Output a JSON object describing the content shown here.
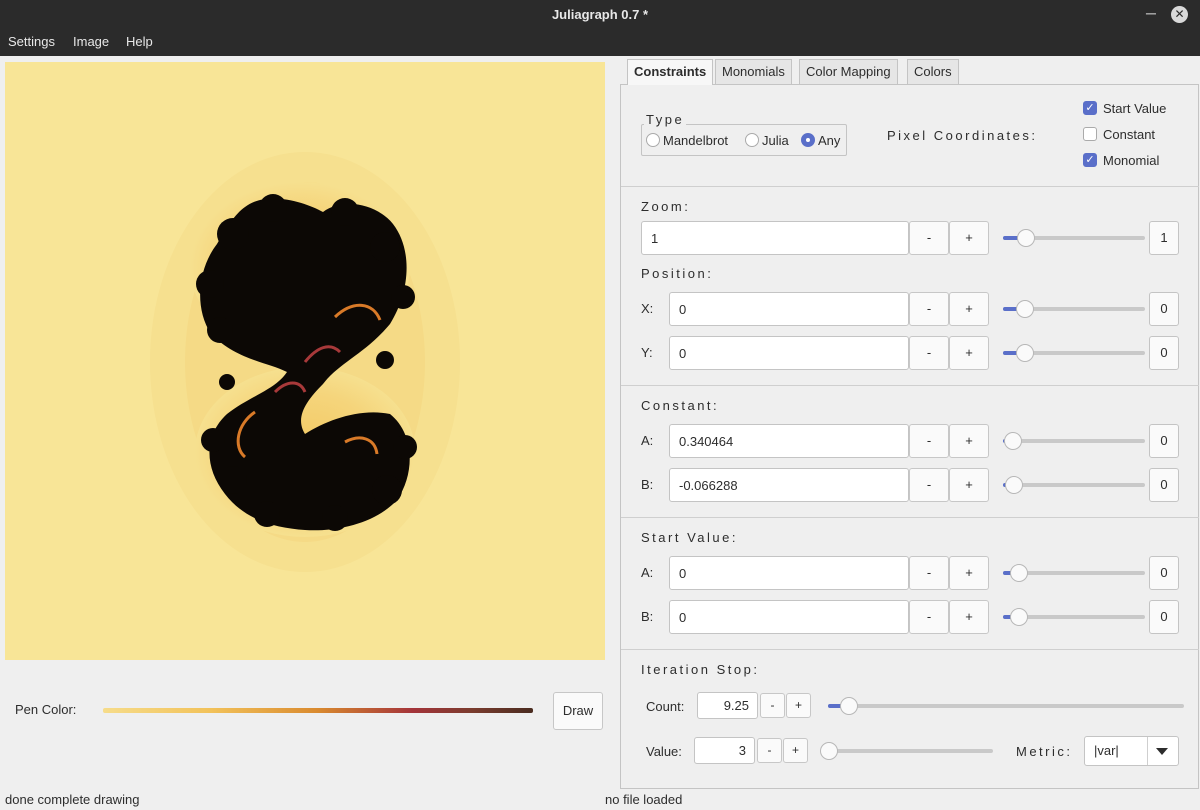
{
  "window": {
    "title": "Juliagraph 0.7 *",
    "minimize_glyph": "─",
    "close_glyph": "✕"
  },
  "menu": [
    "Settings",
    "Image",
    "Help"
  ],
  "canvas_colors": {
    "background": "#f8e597",
    "halo": "#f6e08f",
    "glow": "#f3cd6e",
    "fractal": "#0c0805",
    "accent_orange": "#d97a28",
    "accent_red": "#a8393a"
  },
  "pen": {
    "label": "Pen Color:",
    "draw_label": "Draw"
  },
  "status": {
    "left": "done complete drawing",
    "right": "no file loaded"
  },
  "tabs": [
    "Constraints",
    "Monomials",
    "Color Mapping",
    "Colors"
  ],
  "type": {
    "title": "Type",
    "options": [
      {
        "label": "Mandelbrot",
        "selected": false
      },
      {
        "label": "Julia",
        "selected": false
      },
      {
        "label": "Any",
        "selected": true
      }
    ]
  },
  "pixel": {
    "title": "Pixel Coordinates:",
    "checks": [
      {
        "label": "Start Value",
        "checked": true
      },
      {
        "label": "Constant",
        "checked": false
      },
      {
        "label": "Monomial",
        "checked": true
      }
    ]
  },
  "zoom": {
    "title": "Zoom:",
    "value": "1",
    "slider_value": "1"
  },
  "position": {
    "title": "Position:",
    "x": {
      "label": "X:",
      "value": "0",
      "slider_value": "0"
    },
    "y": {
      "label": "Y:",
      "value": "0",
      "slider_value": "0"
    }
  },
  "constant": {
    "title": "Constant:",
    "a": {
      "label": "A:",
      "value": "0.340464",
      "slider_value": "0"
    },
    "b": {
      "label": "B:",
      "value": "-0.066288",
      "slider_value": "0"
    }
  },
  "start_value": {
    "title": "Start Value:",
    "a": {
      "label": "A:",
      "value": "0",
      "slider_value": "0"
    },
    "b": {
      "label": "B:",
      "value": "0",
      "slider_value": "0"
    }
  },
  "iteration": {
    "title": "Iteration Stop:",
    "count": {
      "label": "Count:",
      "value": "9.25"
    },
    "value": {
      "label": "Value:",
      "value": "3"
    },
    "metric": {
      "label": "Metric:",
      "value": "|var|"
    }
  },
  "buttons": {
    "minus": "-",
    "plus": "+"
  },
  "accent": "#5a6fc9"
}
